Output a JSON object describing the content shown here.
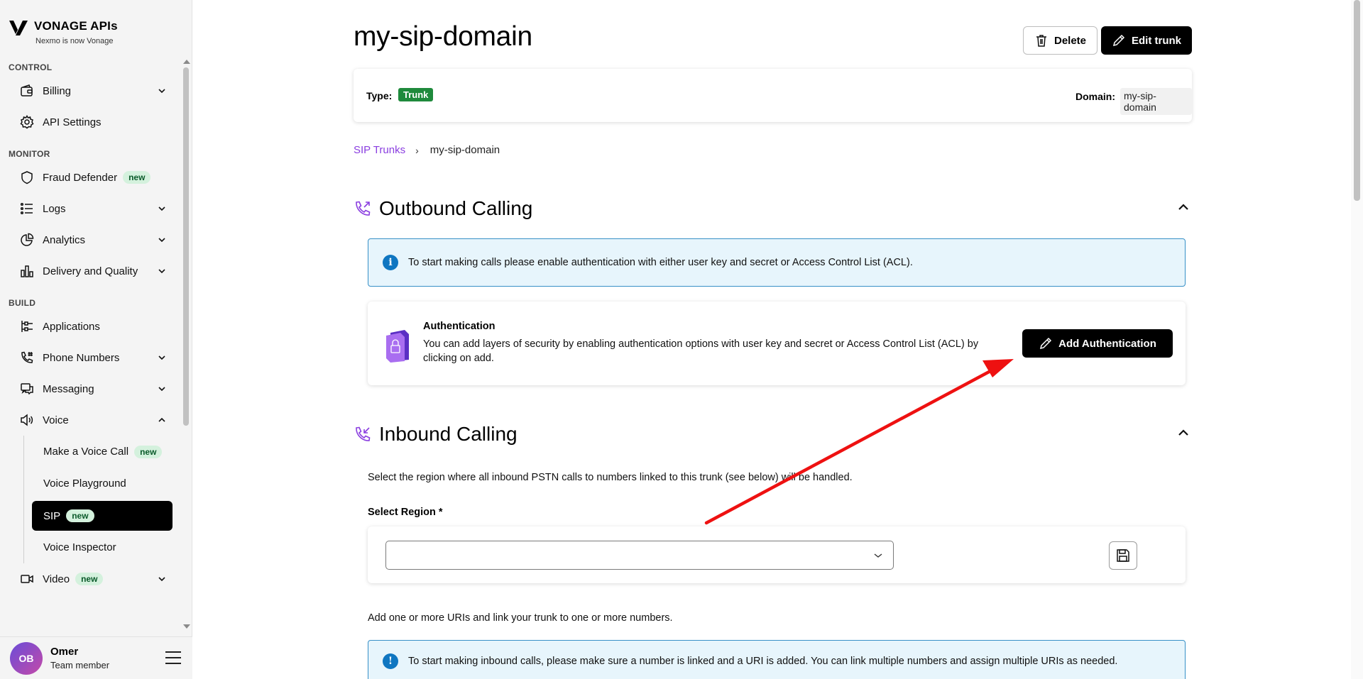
{
  "brand": {
    "title": "VONAGE APIs",
    "subtitle": "Nexmo is now Vonage"
  },
  "sidebar": {
    "sections": [
      {
        "label": "CONTROL"
      },
      {
        "label": "MONITOR"
      },
      {
        "label": "BUILD"
      }
    ],
    "items": {
      "billing": "Billing",
      "api_settings": "API Settings",
      "fraud_defender": "Fraud Defender",
      "logs": "Logs",
      "analytics": "Analytics",
      "delivery_quality": "Delivery and Quality",
      "applications": "Applications",
      "phone_numbers": "Phone Numbers",
      "messaging": "Messaging",
      "voice": "Voice",
      "make_voice_call": "Make a Voice Call",
      "voice_playground": "Voice Playground",
      "sip": "SIP",
      "voice_inspector": "Voice Inspector",
      "video": "Video"
    },
    "badge_new": "new",
    "user": {
      "initials": "OB",
      "name": "Omer",
      "role": "Team member"
    }
  },
  "page": {
    "title": "my-sip-domain",
    "delete_label": "Delete",
    "edit_label": "Edit trunk",
    "type_label": "Type:",
    "type_value": "Trunk",
    "domain_label": "Domain:",
    "domain_value": "my-sip-domain",
    "breadcrumb": {
      "link": "SIP Trunks",
      "separator": "›",
      "current": "my-sip-domain"
    }
  },
  "outbound": {
    "title": "Outbound Calling",
    "alert": "To start making calls please enable authentication with either user key and secret or Access Control List (ACL).",
    "auth_title": "Authentication",
    "auth_desc": "You can add layers of security by enabling authentication options with user key and secret or Access Control List (ACL) by clicking on add.",
    "add_auth_label": "Add Authentication"
  },
  "inbound": {
    "title": "Inbound Calling",
    "desc": "Select the region where all inbound PSTN calls to numbers linked to this trunk (see below) will be handled.",
    "region_label": "Select Region *",
    "region_value": "",
    "uri_desc": "Add one or more URIs and link your trunk to one or more numbers.",
    "alert": "To start making inbound calls, please make sure a number is linked and a URI is added. You can link multiple numbers and assign multiple URIs as needed."
  },
  "colors": {
    "accent_purple": "#8a3ee0",
    "badge_green": "#1f8a3c",
    "info_blue": "#0f76c1",
    "annotation_red": "#ee1111"
  }
}
